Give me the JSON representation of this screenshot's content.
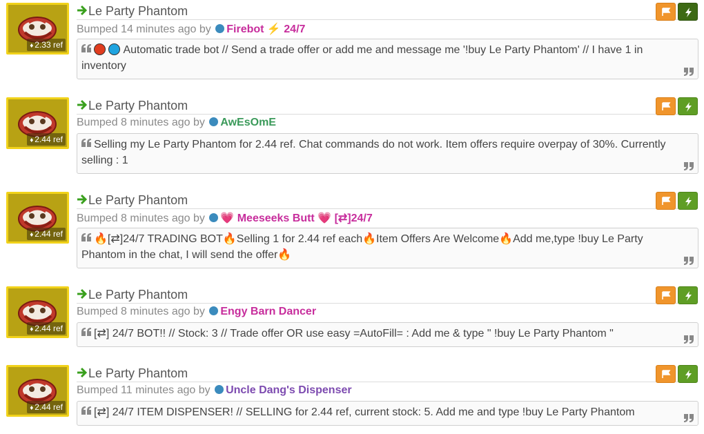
{
  "item_name": "Le Party Phantom",
  "colors": {
    "accent_arrow": "#3aa01e",
    "flag_button": "#f0952c",
    "bolt_button": "#5f9e25",
    "tile_border": "#f1d21a",
    "status_dot": "#3b8bbd"
  },
  "icons": {
    "arrow": "arrow-right-icon",
    "price": "tag-icon",
    "flag": "flag-icon",
    "bolt": "bolt-icon",
    "quote_open": "quote-left-icon",
    "quote_close": "quote-right-icon",
    "status": "status-dot-icon"
  },
  "listings": [
    {
      "price": "2.33 ref",
      "title": "Le Party Phantom",
      "bumped_text": "Bumped 14 minutes ago by",
      "user": "Firebot ⚡ 24/7",
      "user_color": "#c72d9c",
      "description": "Automatic trade bot // Send a trade offer or add me and message me '!buy Le Party Phantom' // I have 1 in inventory"
    },
    {
      "price": "2.44 ref",
      "title": "Le Party Phantom",
      "bumped_text": "Bumped 8 minutes ago by",
      "user": "AwEsOmE",
      "user_color": "#3b9a5a",
      "description": "Selling my Le Party Phantom for 2.44 ref. Chat commands do not work. Item offers require overpay of 30%. Currently selling : 1"
    },
    {
      "price": "2.44 ref",
      "title": "Le Party Phantom",
      "bumped_text": "Bumped 8 minutes ago by",
      "user": "💗 Meeseeks Butt 💗 [⇄]24/7",
      "user_color": "#c72d9c",
      "description": "🔥[⇄]24/7 TRADING BOT🔥Selling 1 for 2.44 ref each🔥Item Offers Are Welcome🔥Add me,type !buy Le Party Phantom in the chat, I will send the offer🔥"
    },
    {
      "price": "2.44 ref",
      "title": "Le Party Phantom",
      "bumped_text": "Bumped 8 minutes ago by",
      "user": "Engy Barn Dancer",
      "user_color": "#c72d9c",
      "description": "[⇄] 24/7 BOT!! // Stock: 3 // Trade offer OR use easy =AutoFill= : Add me & type \" !buy Le Party Phantom \""
    },
    {
      "price": "2.44 ref",
      "title": "Le Party Phantom",
      "bumped_text": "Bumped 11 minutes ago by",
      "user": "Uncle Dang's Dispenser",
      "user_color": "#7d4bb0",
      "description": "[⇄] 24/7 ITEM DISPENSER! // SELLING for 2.44 ref, current stock: 5. Add me and type !buy Le Party Phantom"
    }
  ]
}
